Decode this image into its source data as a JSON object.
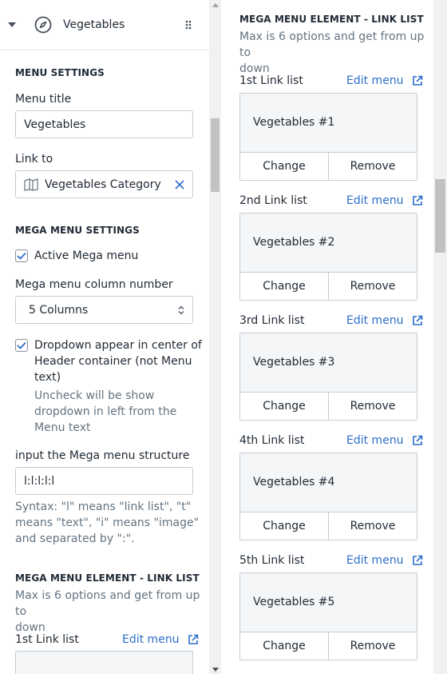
{
  "header": {
    "title": "Vegetables",
    "icon": "compass-icon"
  },
  "menu_settings": {
    "section_title": "MENU SETTINGS",
    "menu_title_label": "Menu title",
    "menu_title_value": "Vegetables",
    "link_to_label": "Link to",
    "link_to_value": "Vegetables Category"
  },
  "mega_settings": {
    "section_title": "MEGA MENU SETTINGS",
    "active_label": "Active Mega menu",
    "active_checked": true,
    "column_label": "Mega menu column number",
    "column_value": "5 Columns",
    "dropdown_center_label_1": "Dropdown appear in center of",
    "dropdown_center_label_2": "Header container (not Menu",
    "dropdown_center_label_3": "text)",
    "dropdown_center_checked": true,
    "dropdown_help_1": "Uncheck will be show",
    "dropdown_help_2": "dropdown in left from the",
    "dropdown_help_3": "Menu text",
    "structure_label": "input the Mega menu structure",
    "structure_value": "l:l:l:l:l",
    "syntax_1": "Syntax: \"l\" means \"link list\", \"t\"",
    "syntax_2": "means \"text\", \"i\" means \"image\"",
    "syntax_3": "and separated by \":\"."
  },
  "link_list_section": {
    "title": "MEGA MENU ELEMENT - LINK LIST",
    "help_1": "Max is 6 options and get from up to",
    "help_2": "down",
    "edit_label": "Edit menu",
    "change_label": "Change",
    "remove_label": "Remove",
    "lists": [
      {
        "label": "1st Link list",
        "menu": "Vegetables #1"
      },
      {
        "label": "2nd Link list",
        "menu": "Vegetables #2"
      },
      {
        "label": "3rd Link list",
        "menu": "Vegetables #3"
      },
      {
        "label": "4th Link list",
        "menu": "Vegetables #4"
      },
      {
        "label": "5th Link list",
        "menu": "Vegetables #5"
      }
    ]
  },
  "colors": {
    "link": "#2c6ecb",
    "muted": "#637381",
    "border": "#c4cdd5",
    "slot_bg": "#f4f6f8"
  }
}
